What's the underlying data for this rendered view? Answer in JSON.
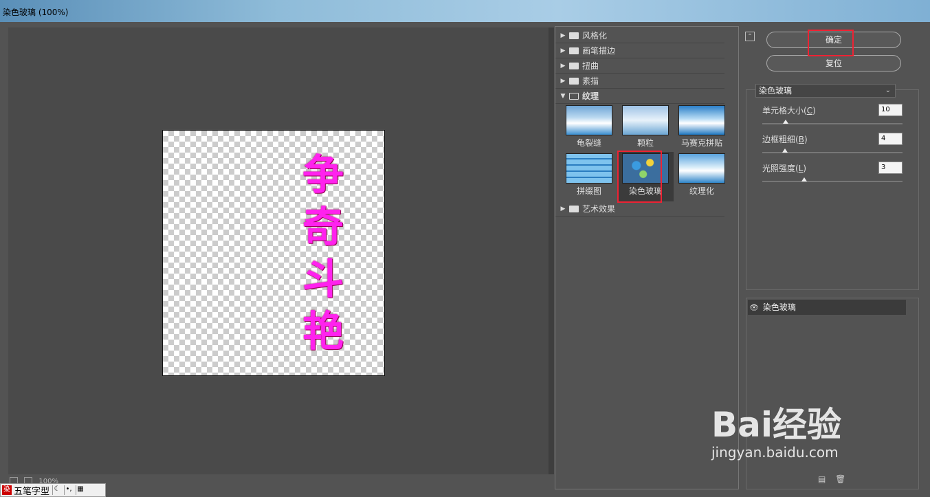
{
  "window": {
    "title": "染色玻璃 (100%)"
  },
  "preview": {
    "characters": [
      "争",
      "奇",
      "斗",
      "艳"
    ],
    "zoom": "100%"
  },
  "ime": {
    "label": "五笔字型"
  },
  "filters": {
    "categories_top": [
      "风格化",
      "画笔描边",
      "扭曲",
      "素描"
    ],
    "active_category": "纹理",
    "thumbnails": [
      {
        "name": "龟裂缝"
      },
      {
        "name": "颗粒"
      },
      {
        "name": "马赛克拼贴"
      },
      {
        "name": "拼缀图"
      },
      {
        "name": "染色玻璃"
      },
      {
        "name": "纹理化"
      }
    ],
    "categories_bottom": [
      "艺术效果"
    ]
  },
  "buttons": {
    "ok": "确定",
    "reset": "复位"
  },
  "settings": {
    "filter_select": "染色玻璃",
    "params": [
      {
        "label": "单元格大小",
        "key": "C",
        "value": "10"
      },
      {
        "label": "边框粗细",
        "key": "B",
        "value": "4"
      },
      {
        "label": "光照强度",
        "key": "L",
        "value": "3"
      }
    ]
  },
  "layers": {
    "items": [
      {
        "name": "染色玻璃"
      }
    ]
  },
  "watermark": {
    "brand": "Bai经验",
    "url": "jingyan.baidu.com"
  },
  "colors": {
    "highlight": "#e02233",
    "glass_text": "#ff22ee"
  },
  "icons": [
    "collapse-icon",
    "folder-icon",
    "eye-icon",
    "new-layer-icon",
    "trash-icon"
  ]
}
